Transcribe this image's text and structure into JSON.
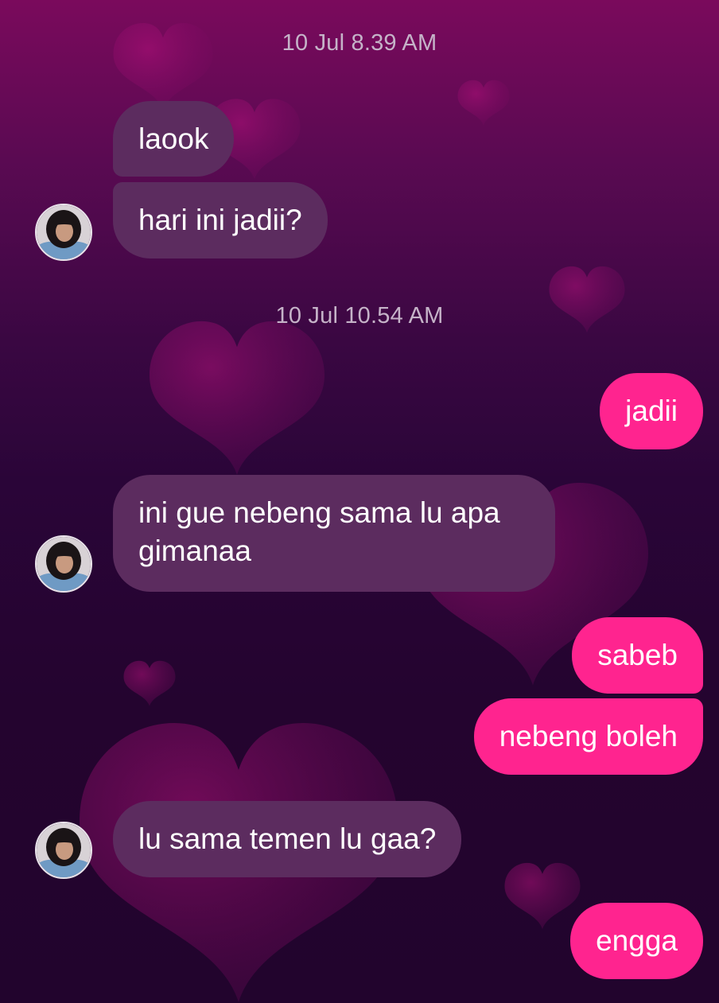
{
  "colors": {
    "received_bubble": "#5c2c5f",
    "sent_bubble": "#ff248f",
    "timestamp_text": "#c5b3c8",
    "background_top": "#7a0a5c",
    "background_bottom": "#22042d"
  },
  "contact": {
    "avatar_icon": "contact-avatar"
  },
  "timestamps": [
    "10 Jul 8.39 AM",
    "10 Jul 10.54 AM"
  ],
  "messages": [
    {
      "from": "contact",
      "text": "laook"
    },
    {
      "from": "contact",
      "text": "hari ini jadii?"
    },
    {
      "from": "me",
      "text": "jadii"
    },
    {
      "from": "contact",
      "lines": [
        "ini gue nebeng sama lu apa",
        "gimanaa"
      ]
    },
    {
      "from": "me",
      "text": "sabeb"
    },
    {
      "from": "me",
      "text": "nebeng boleh"
    },
    {
      "from": "contact",
      "text": "lu sama temen lu gaa?"
    },
    {
      "from": "me",
      "text": "engga"
    }
  ]
}
